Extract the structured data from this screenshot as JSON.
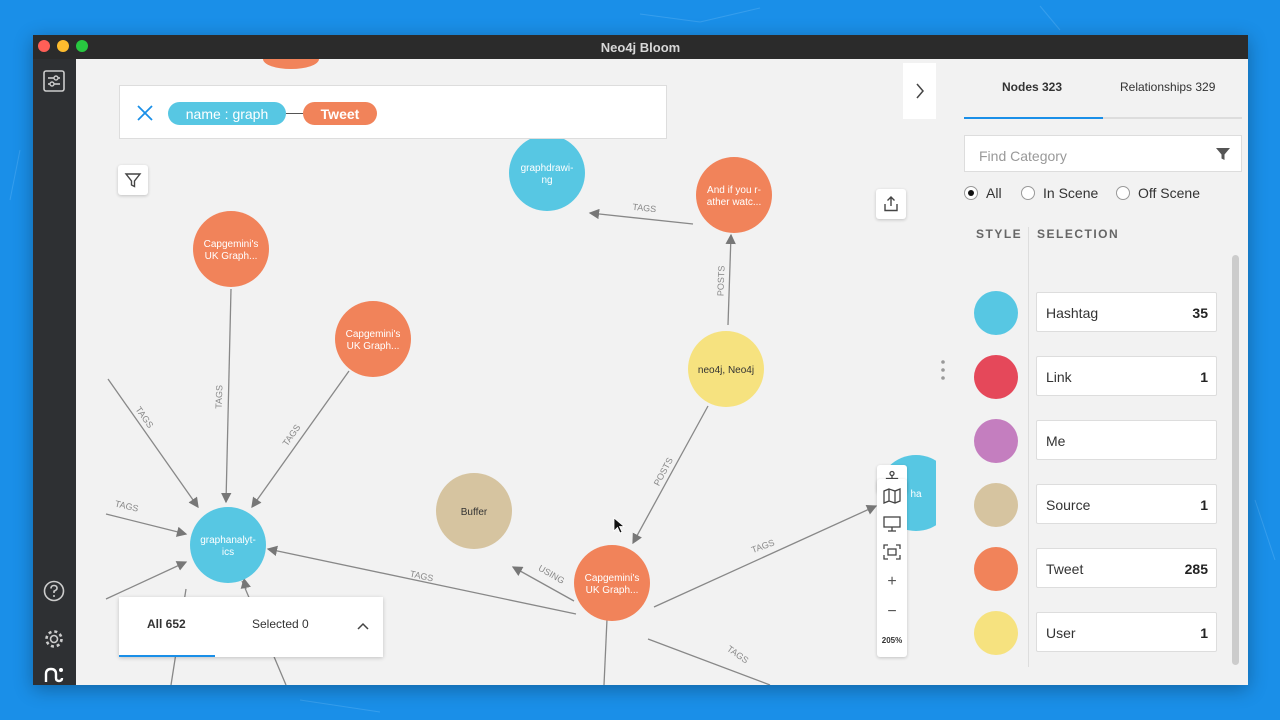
{
  "window": {
    "title": "Neo4j Bloom"
  },
  "search": {
    "chip_name": "name : graph",
    "chip_tweet": "Tweet"
  },
  "graph": {
    "nodes": [
      {
        "id": "n1",
        "label1": "Capgemini's",
        "label2": "UK Graph...",
        "color": "#f1835a"
      },
      {
        "id": "n2",
        "label1": "Capgemini's",
        "label2": "UK Graph...",
        "color": "#f1835a"
      },
      {
        "id": "n3",
        "label1": "graphdrawi-",
        "label2": "ng",
        "color": "#57c7e3"
      },
      {
        "id": "n4",
        "label1": "And if you r-",
        "label2": "ather watc...",
        "color": "#f1835a"
      },
      {
        "id": "n5",
        "label1": "neo4j, Neo4j",
        "label2": "",
        "color": "#f6e27f"
      },
      {
        "id": "n6",
        "label1": "graphanalyt-",
        "label2": "ics",
        "color": "#57c7e3"
      },
      {
        "id": "n7",
        "label1": "Buffer",
        "label2": "",
        "color": "#d6c4a0"
      },
      {
        "id": "n8",
        "label1": "Capgemini's",
        "label2": "UK Graph...",
        "color": "#f1835a"
      },
      {
        "id": "n9",
        "label1": "ha",
        "label2": "",
        "color": "#57c7e3"
      }
    ],
    "edge_labels": {
      "tags": "TAGS",
      "posts": "POSTS",
      "using": "USING"
    }
  },
  "zoom": {
    "level": "205%",
    "plus": "+",
    "minus": "−"
  },
  "counts": {
    "all": "All 652",
    "selected": "Selected 0"
  },
  "panel": {
    "tab_nodes": "Nodes 323",
    "tab_relationships": "Relationships 329",
    "find_placeholder": "Find Category",
    "radio_all": "All",
    "radio_in": "In Scene",
    "radio_off": "Off Scene",
    "col_style": "STYLE",
    "col_selection": "SELECTION",
    "categories": [
      {
        "name": "Hashtag",
        "count": "35",
        "color": "#57c7e3"
      },
      {
        "name": "Link",
        "count": "1",
        "color": "#e5485a"
      },
      {
        "name": "Me",
        "count": "",
        "color": "#c47ebf"
      },
      {
        "name": "Source",
        "count": "1",
        "color": "#d6c4a0"
      },
      {
        "name": "Tweet",
        "count": "285",
        "color": "#f1835a"
      },
      {
        "name": "User",
        "count": "1",
        "color": "#f6e27f"
      }
    ]
  }
}
